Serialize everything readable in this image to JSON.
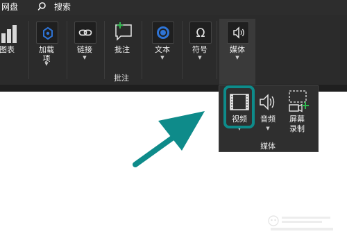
{
  "top_tabs": {
    "netdisk": "网盘",
    "search": "搜索"
  },
  "ribbon": {
    "buttons": [
      {
        "label": "图表"
      },
      {
        "label": "加载",
        "label2": "项"
      },
      {
        "label": "链接"
      },
      {
        "label": "批注"
      },
      {
        "label": "文本"
      },
      {
        "label": "符号"
      },
      {
        "label": "媒体"
      }
    ],
    "group_labels": {
      "comments": "批注"
    }
  },
  "media_dropdown": {
    "items": [
      {
        "label": "视频",
        "icon": "video-icon"
      },
      {
        "label": "音频",
        "icon": "audio-icon"
      },
      {
        "label": "屏幕",
        "label2": "录制",
        "icon": "screen-recording-icon"
      }
    ],
    "group_label": "媒体"
  },
  "colors": {
    "ribbon_bg": "#2b2b2b",
    "dropdown_bg": "#2f2f2f",
    "accent_teal": "#0e8b8a",
    "accent_green": "#2fb84f",
    "accent_blue": "#2e74d6"
  }
}
